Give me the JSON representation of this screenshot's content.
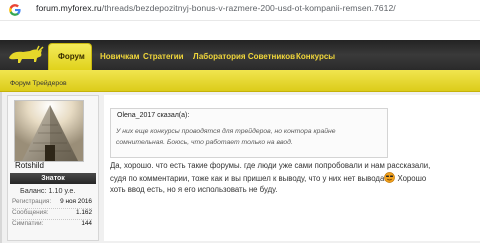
{
  "browser": {
    "url_domain": "forum.myforex.ru",
    "url_path": "/threads/bezdepozitnyj-bonus-v-razmere-200-usd-ot-kompanii-remsen.7612/",
    "icon": "google-icon"
  },
  "nav": {
    "tabs": [
      {
        "label": "Форум",
        "active": true
      },
      {
        "label": "Новичкам"
      },
      {
        "label": "Стратегии"
      },
      {
        "label": "Лаборатория Советников"
      },
      {
        "label": "Конкурсы"
      }
    ]
  },
  "breadcrumb": "Форум Трейдеров",
  "user": {
    "name": "Rotshild",
    "rank": "Знаток",
    "balance": "Баланс: 1.10 у.е.",
    "stats": [
      {
        "label": "Регистрация:",
        "value": "9 ноя 2016"
      },
      {
        "label": "Сообщения:",
        "value": "1.162"
      },
      {
        "label": "Симпатии:",
        "value": "144"
      }
    ]
  },
  "post": {
    "quote": {
      "author": "Olena_2017 сказал(а):",
      "lines": [
        "У них еще конкурсы проводятся для трейдеров, но контора крайне",
        "сомнительная. Боюсь, что работает только на ввод."
      ]
    },
    "lines": [
      "Да, хорошо. что есть такие форумы. где люди уже сами попробовали и нам рассказали,",
      "судя по комментарии, тоже как и вы пришел к выводу, что у них нет вывода",
      "хоть ввод есть, но я его использовать не буду."
    ],
    "line2_tail": " Хорошо"
  },
  "colors": {
    "accent_yellow": "#e6d82a",
    "nav_dark": "#2c2c2c",
    "nav_text": "#f0d63a",
    "rank_bg": "#2e2e2e"
  }
}
